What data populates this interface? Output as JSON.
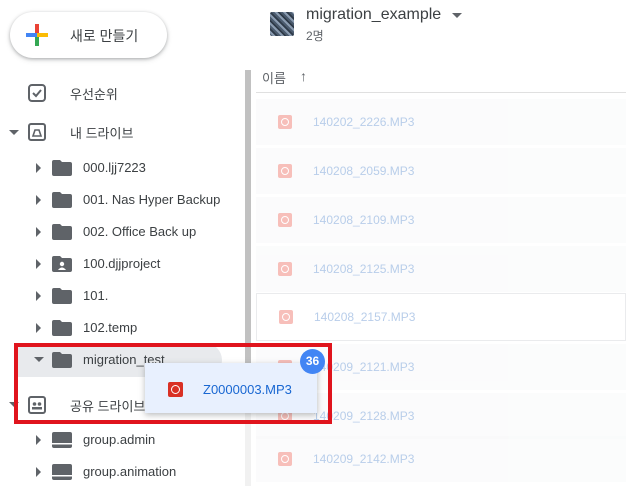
{
  "sidebar": {
    "new_button_label": "새로 만들기",
    "priority_label": "우선순위",
    "my_drive_label": "내 드라이브",
    "shared_drives_label": "공유 드라이브",
    "folders": [
      {
        "name": "000.ljj7223"
      },
      {
        "name": "001. Nas Hyper Backup"
      },
      {
        "name": "002. Office Back up"
      },
      {
        "name": "100.djjproject"
      },
      {
        "name": "101."
      },
      {
        "name": "102.temp"
      },
      {
        "name": "migration_test"
      }
    ],
    "shared_folders": [
      {
        "name": "group.admin"
      },
      {
        "name": "group.animation"
      }
    ]
  },
  "header": {
    "title": "migration_example",
    "subtitle": "2명"
  },
  "list": {
    "sort_column": "이름",
    "sort_arrow": "↑",
    "files": [
      "140202_2226.MP3",
      "140208_2059.MP3",
      "140208_2109.MP3",
      "140208_2125.MP3",
      "140208_2157.MP3",
      "140209_2121.MP3",
      "140209_2128.MP3",
      "140209_2142.MP3"
    ]
  },
  "drag": {
    "file_name": "Z0000003.MP3",
    "count": "36"
  },
  "colors": {
    "accent": "#4285f4",
    "highlight_frame": "#e0141d",
    "audio_icon": "#d93025"
  }
}
